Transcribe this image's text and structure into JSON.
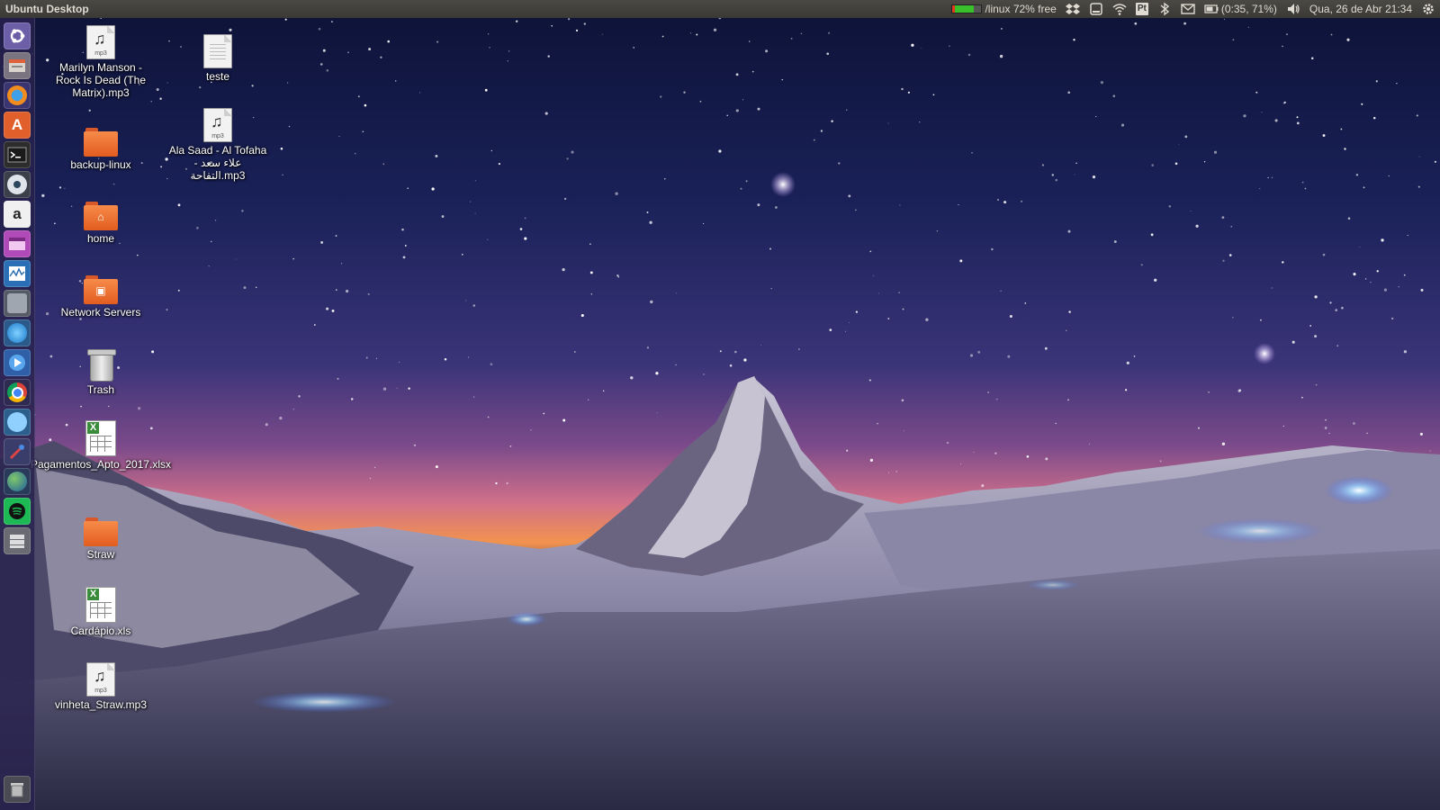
{
  "panel": {
    "app_title": "Ubuntu Desktop",
    "disk": {
      "text": "/linux 72% free",
      "free_fraction": 0.72
    },
    "keyboard_layout": "Pt",
    "battery": "(0:35, 71%)",
    "clock": "Qua, 26 de Abr 21:34"
  },
  "launcher": {
    "items": [
      {
        "name": "dash-home",
        "icon": "ubuntu-logo-icon"
      },
      {
        "name": "files",
        "icon": "file-manager-icon"
      },
      {
        "name": "firefox",
        "icon": "firefox-icon"
      },
      {
        "name": "software-center",
        "icon": "software-center-icon"
      },
      {
        "name": "terminal",
        "icon": "terminal-icon"
      },
      {
        "name": "steam",
        "icon": "steam-icon"
      },
      {
        "name": "amazon",
        "icon": "amazon-icon",
        "glyph": "a"
      },
      {
        "name": "app-purple",
        "icon": "window-app-icon"
      },
      {
        "name": "system-monitor",
        "icon": "system-monitor-icon"
      },
      {
        "name": "app-gray",
        "icon": "app-icon"
      },
      {
        "name": "app-blue",
        "icon": "circle-app-icon"
      },
      {
        "name": "media-player",
        "icon": "play-icon"
      },
      {
        "name": "chrome",
        "icon": "chrome-icon"
      },
      {
        "name": "app-skype",
        "icon": "chat-icon"
      },
      {
        "name": "app-tools",
        "icon": "tools-icon"
      },
      {
        "name": "globe",
        "icon": "globe-icon"
      },
      {
        "name": "spotify",
        "icon": "spotify-icon"
      },
      {
        "name": "drives",
        "icon": "drives-icon"
      }
    ],
    "trash_icon": "trash-icon"
  },
  "desktop": {
    "icons": [
      {
        "name": "mp3-marilyn",
        "type": "mp3",
        "label": "Marilyn Manson - Rock Is Dead (The Matrix).mp3"
      },
      {
        "name": "folder-backup-linux",
        "type": "folder",
        "label": "backup-linux"
      },
      {
        "name": "folder-home",
        "type": "home",
        "label": "home"
      },
      {
        "name": "network-servers",
        "type": "network",
        "label": "Network Servers"
      },
      {
        "name": "trash",
        "type": "trash",
        "label": "Trash"
      },
      {
        "name": "xlsx-pagamentos",
        "type": "sheet",
        "label": "Pagamentos_Apto_2017.xlsx"
      },
      {
        "name": "folder-straw",
        "type": "folder",
        "label": "Straw"
      },
      {
        "name": "xls-cardapio",
        "type": "sheet",
        "label": "Cardápio.xls"
      },
      {
        "name": "mp3-vinheta",
        "type": "mp3",
        "label": "vinheta_Straw.mp3"
      },
      {
        "name": "file-teste",
        "type": "text",
        "label": "teste"
      },
      {
        "name": "mp3-ala-saad",
        "type": "mp3",
        "label": "Ala Saad - Al Tofaha علاء سعد - التفاحة.mp3"
      }
    ],
    "mp3_tag": "mp3"
  },
  "colors": {
    "panel_bg": "#3c3b37",
    "launcher_bg": "#28224e",
    "folder_orange": "#f07a3a",
    "disk_green": "#39c02b"
  }
}
